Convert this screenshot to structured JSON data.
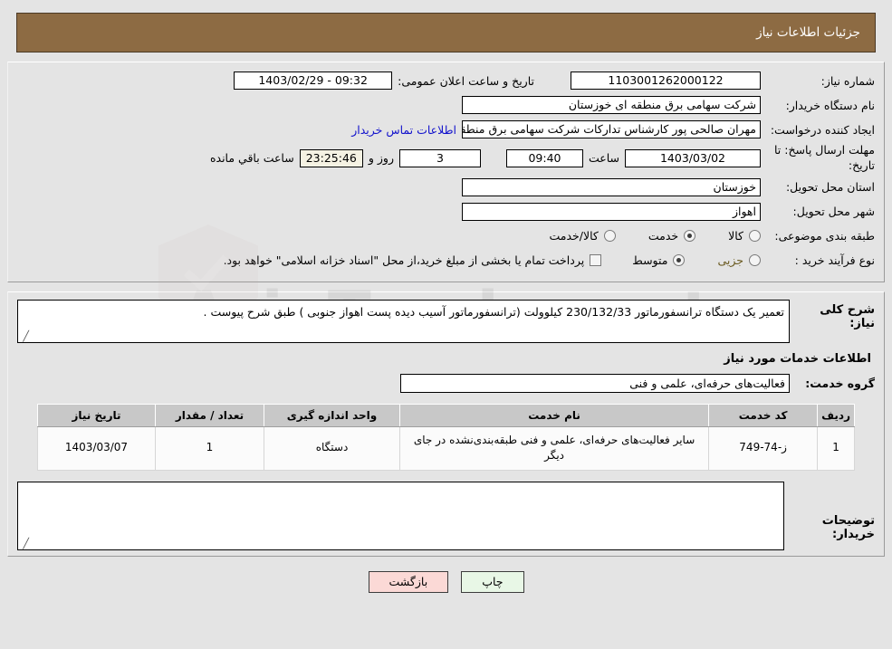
{
  "header": {
    "title": "جزئیات اطلاعات نیاز"
  },
  "watermark": {
    "text": "AriaTender.net"
  },
  "top_form": {
    "need_number_label": "شماره نیاز:",
    "need_number_value": "1103001262000122",
    "public_announce_label": "تاریخ و ساعت اعلان عمومی:",
    "public_announce_value": "09:32 - 1403/02/29",
    "buyer_org_label": "نام دستگاه خریدار:",
    "buyer_org_value": "شرکت سهامی برق منطقه ای خوزستان",
    "creator_label": "ایجاد کننده درخواست:",
    "creator_value": "مهران صالحی پور کارشناس تدارکات شرکت سهامی برق منطقه ای خوزستان",
    "contact_link": "اطلاعات تماس خریدار",
    "deadline_label": "مهلت ارسال پاسخ: تا تاریخ:",
    "deadline_date": "1403/03/02",
    "hour_label": "ساعت",
    "deadline_time": "09:40",
    "days_remaining": "3",
    "days_label": "روز و",
    "countdown": "23:25:46",
    "remaining_label": "ساعت باقي مانده",
    "province_label": "استان محل تحویل:",
    "province_value": "خوزستان",
    "city_label": "شهر محل تحویل:",
    "city_value": "اهواز",
    "category_label": "طبقه بندی موضوعی:",
    "category_options": [
      {
        "label": "کالا",
        "selected": false
      },
      {
        "label": "خدمت",
        "selected": true
      },
      {
        "label": "کالا/خدمت",
        "selected": false
      }
    ],
    "process_label": "نوع فرآیند خرید :",
    "process_options": [
      {
        "label": "جزیی",
        "selected": false
      },
      {
        "label": "متوسط",
        "selected": true
      }
    ],
    "treasury_note": "پرداخت تمام یا بخشی از مبلغ خرید،از محل \"اسناد خزانه اسلامی\" خواهد بود."
  },
  "description": {
    "label": "شرح کلی نیاز:",
    "value": "تعمیر یک دستگاه ترانسفورماتور 230/132/33 کیلوولت (ترانسفورماتور آسیب دیده پست اهواز جنوبی ) طبق شرح پیوست ."
  },
  "services_section": {
    "heading": "اطلاعات خدمات مورد نیاز",
    "service_group_label": "گروه خدمت:",
    "service_group_value": "فعالیت‌های حرفه‌ای، علمی و فنی"
  },
  "table": {
    "columns": [
      "ردیف",
      "کد خدمت",
      "نام خدمت",
      "واحد اندازه گیری",
      "تعداد / مقدار",
      "تاریخ نیاز"
    ],
    "rows": [
      {
        "index": "1",
        "code": "ز-74-749",
        "name": "سایر فعالیت‌های حرفه‌ای، علمی و فنی طبقه‌بندی‌نشده در جای دیگر",
        "unit": "دستگاه",
        "quantity": "1",
        "need_date": "1403/03/07"
      }
    ]
  },
  "comments": {
    "label": "توضیحات خریدار:",
    "value": ""
  },
  "footer": {
    "print_label": "چاپ",
    "back_label": "بازگشت"
  },
  "colors": {
    "header_bg": "#8d6b43",
    "page_bg": "#e4e4e4",
    "link": "#1111cc",
    "countdown_bg": "#f5f2e3",
    "print_btn_bg": "#e8f7e6",
    "back_btn_bg": "#fbd9d6",
    "table_header_bg": "#c8c8c8"
  }
}
